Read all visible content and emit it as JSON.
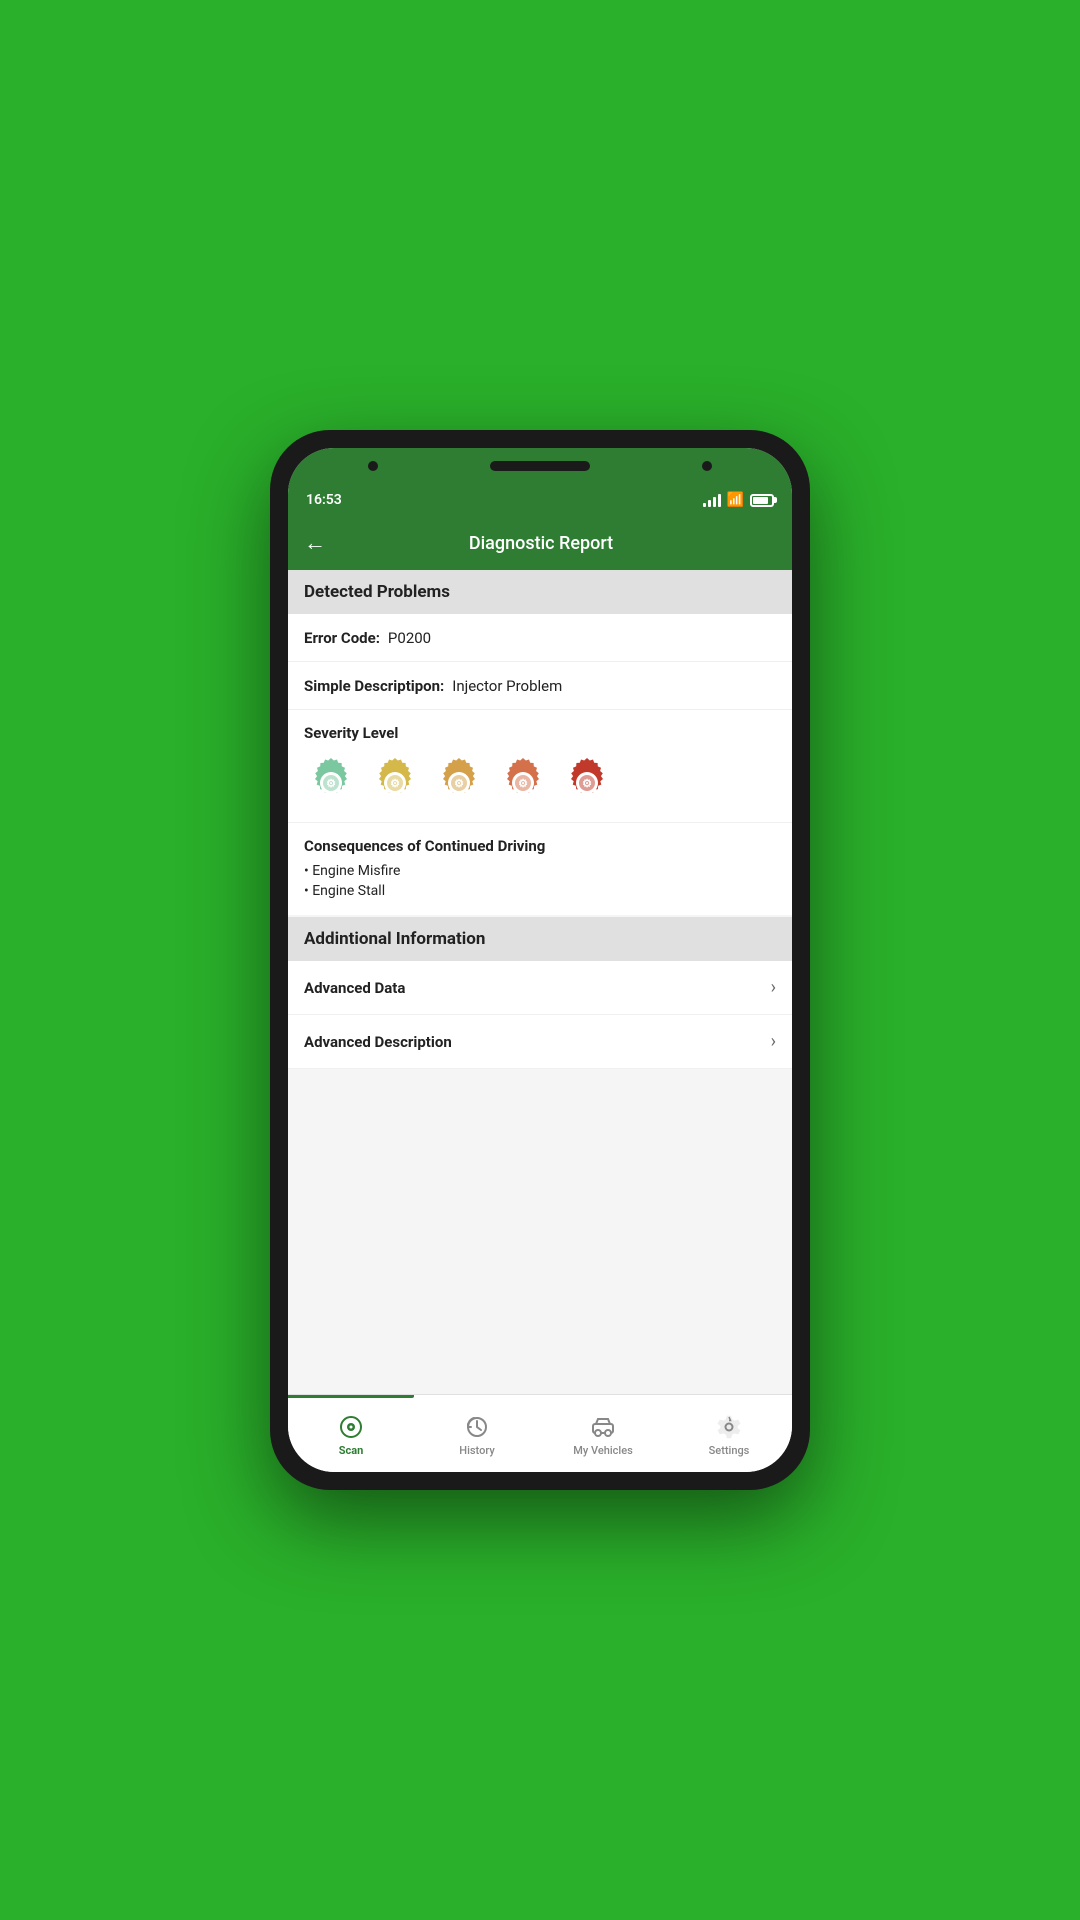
{
  "status_bar": {
    "time": "16:53",
    "signal": "signal-bars",
    "wifi": "wifi",
    "battery": "battery"
  },
  "header": {
    "title": "Diagnostic Report",
    "back_label": "←"
  },
  "detected_problems": {
    "section_title": "Detected Problems",
    "error_code_label": "Error Code:",
    "error_code_value": "P0200",
    "simple_desc_label": "Simple Descriptipon:",
    "simple_desc_value": "Injector Problem",
    "severity_label": "Severity Level",
    "severity_colors": [
      "#7bc8a0",
      "#d4b84a",
      "#d4a04a",
      "#d4704a",
      "#c0392b"
    ],
    "consequences_title": "Consequences of Continued Driving",
    "consequences": [
      "Engine Misfire",
      "Engine Stall"
    ]
  },
  "additional_info": {
    "section_title": "Addintional Information",
    "rows": [
      {
        "label": "Advanced Data",
        "has_chevron": true
      },
      {
        "label": "Advanced Description",
        "has_chevron": true
      }
    ]
  },
  "bottom_nav": {
    "items": [
      {
        "id": "scan",
        "label": "Scan",
        "active": true
      },
      {
        "id": "history",
        "label": "History",
        "active": false
      },
      {
        "id": "my-vehicles",
        "label": "My Vehicles",
        "active": false
      },
      {
        "id": "settings",
        "label": "Settings",
        "active": false
      }
    ]
  }
}
